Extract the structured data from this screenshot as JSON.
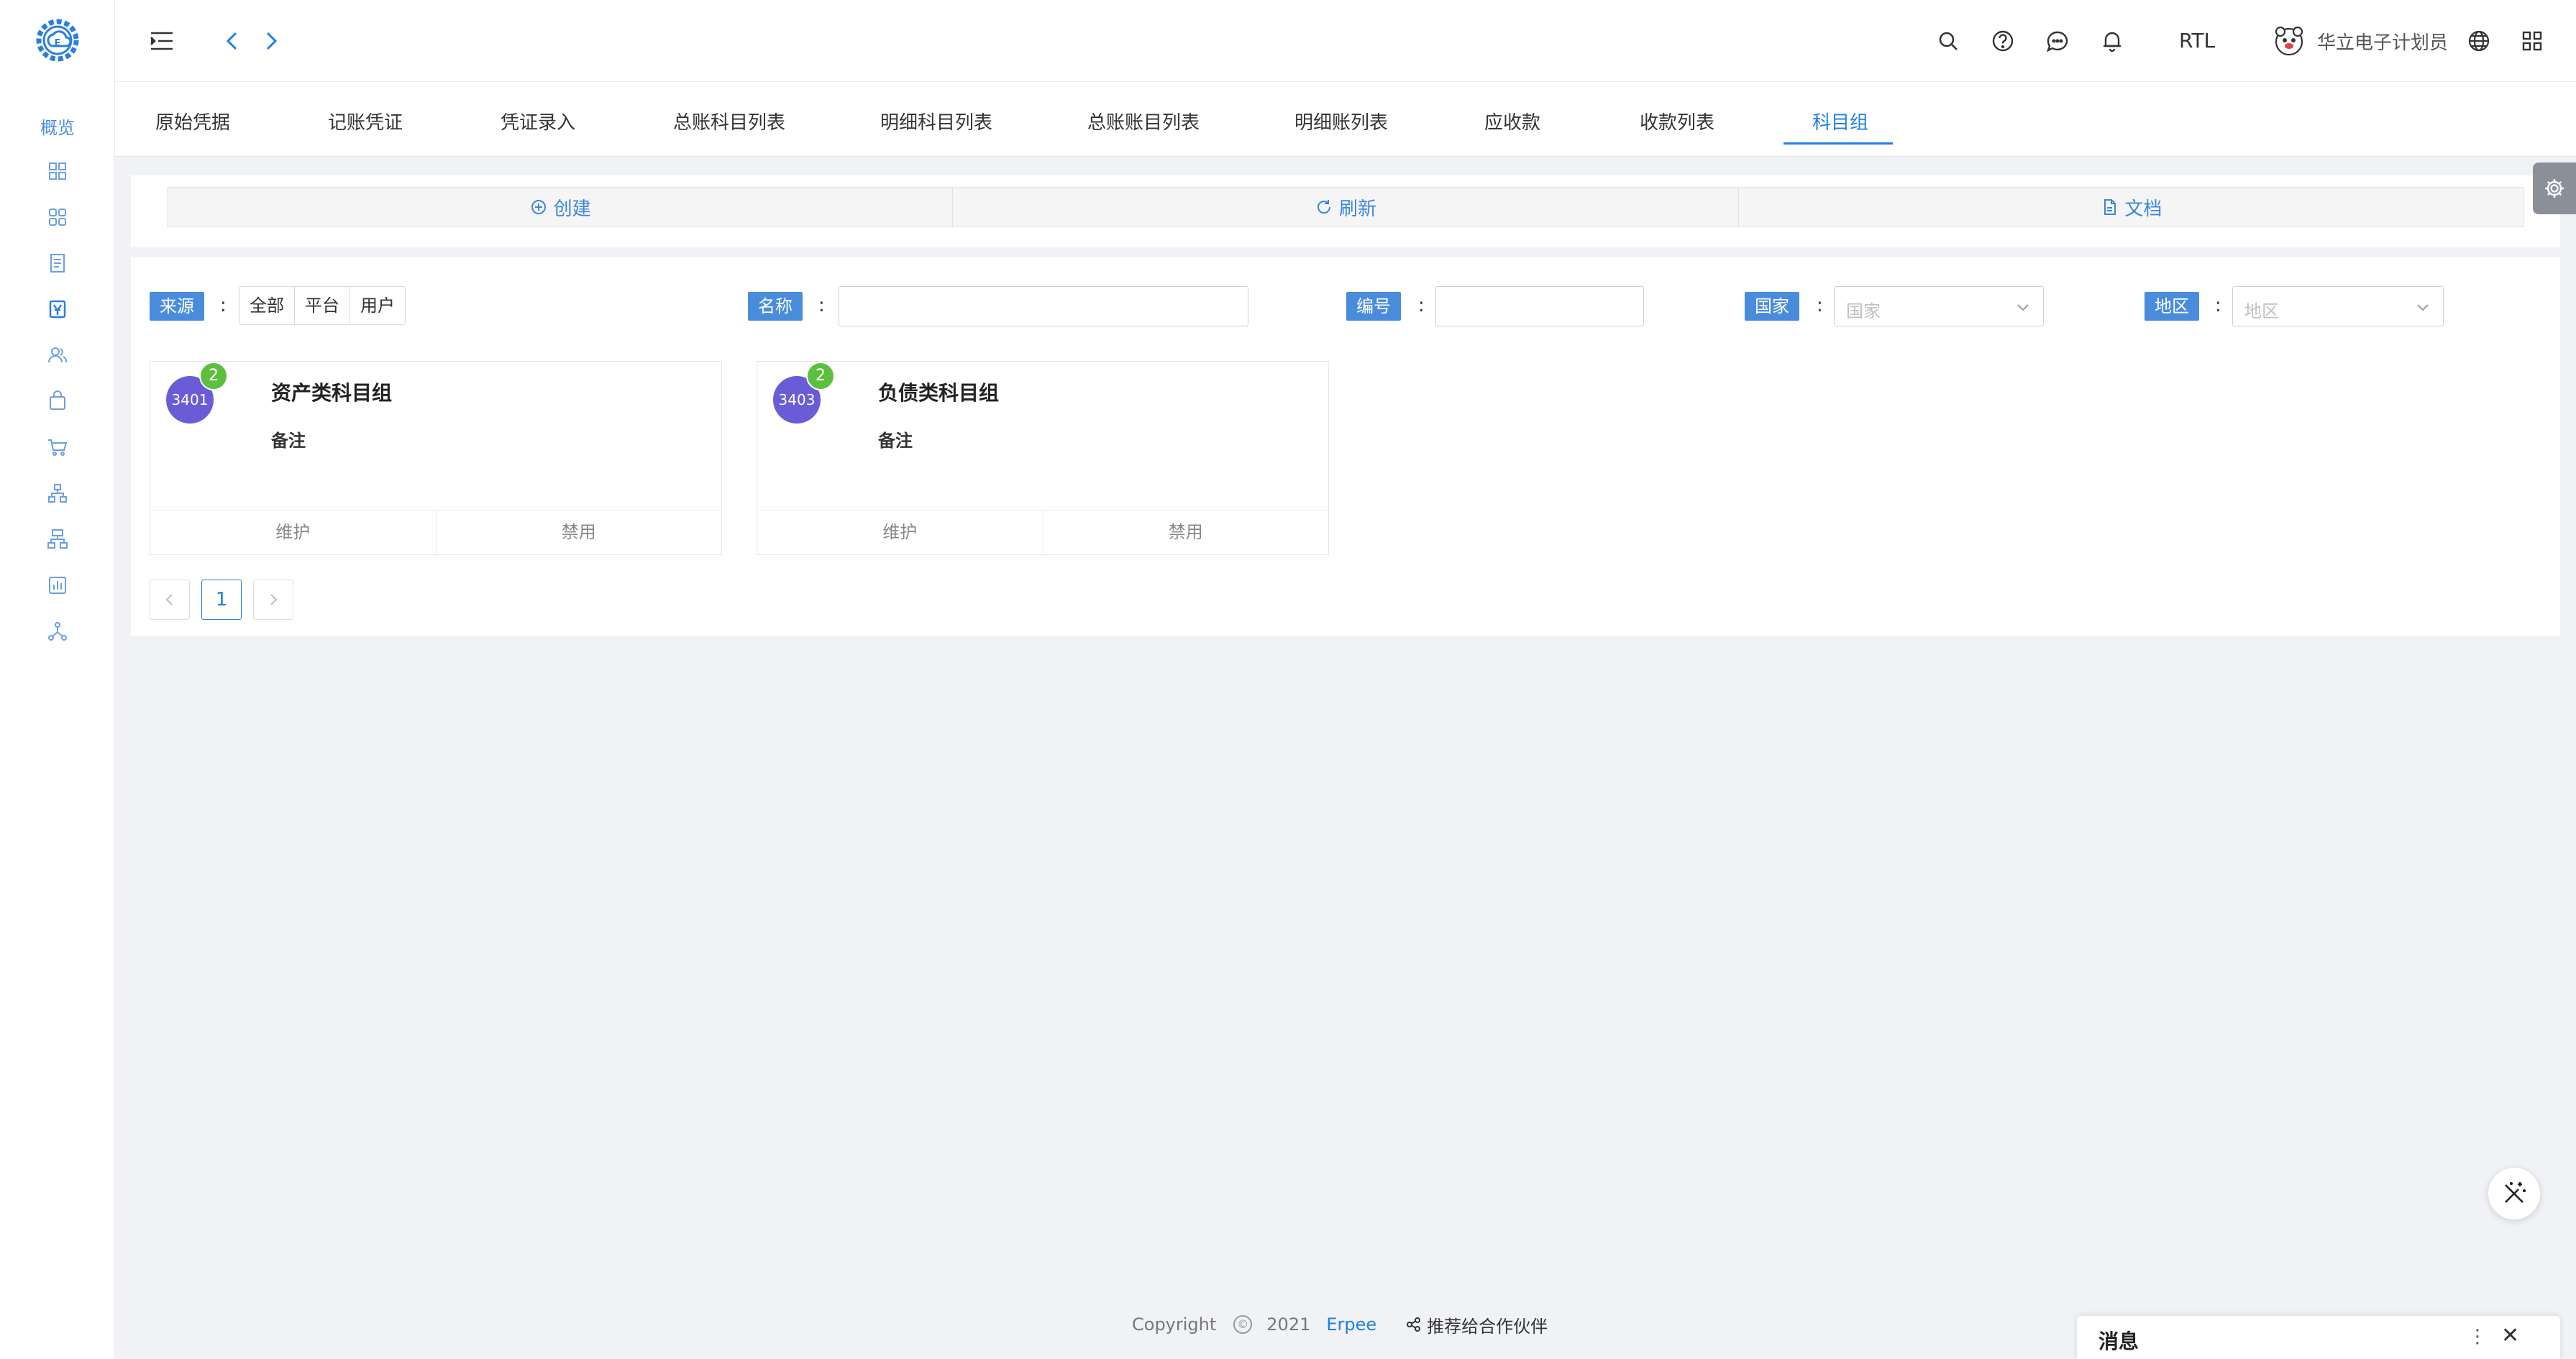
{
  "sidebar": {
    "overview_label": "概览",
    "nav_icons": [
      "dashboard-icon",
      "grid-icon",
      "document-icon",
      "voucher-icon",
      "users-icon",
      "bag-icon",
      "cart-icon",
      "org-chart-icon",
      "hierarchy-icon",
      "report-icon",
      "network-icon"
    ]
  },
  "header": {
    "icons": [
      "menu-fold-icon",
      "back-arrow-icon",
      "forward-arrow-icon",
      "search-icon",
      "help-icon",
      "chat-icon",
      "bell-icon",
      "globe-icon",
      "apps-icon"
    ],
    "rtl_label": "RTL",
    "user_name": "华立电子计划员"
  },
  "tabs": [
    {
      "label": "原始凭据",
      "active": false
    },
    {
      "label": "记账凭证",
      "active": false
    },
    {
      "label": "凭证录入",
      "active": false
    },
    {
      "label": "总账科目列表",
      "active": false
    },
    {
      "label": "明细科目列表",
      "active": false
    },
    {
      "label": "总账账目列表",
      "active": false
    },
    {
      "label": "明细账列表",
      "active": false
    },
    {
      "label": "应收款",
      "active": false
    },
    {
      "label": "收款列表",
      "active": false
    },
    {
      "label": "科目组",
      "active": true
    }
  ],
  "actions": {
    "create": "创建",
    "refresh": "刷新",
    "docs": "文档"
  },
  "filters": {
    "source_label": "来源",
    "source_options": [
      "全部",
      "平台",
      "用户"
    ],
    "name_label": "名称",
    "name_value": "",
    "code_label": "编号",
    "code_value": "",
    "country_label": "国家",
    "country_placeholder": "国家",
    "region_label": "地区",
    "region_placeholder": "地区",
    "colon": ":"
  },
  "cards": [
    {
      "code": "3401",
      "count": "2",
      "title": "资产类科目组",
      "note": "备注",
      "maintain": "维护",
      "disable": "禁用"
    },
    {
      "code": "3403",
      "count": "2",
      "title": "负债类科目组",
      "note": "备注",
      "maintain": "维护",
      "disable": "禁用"
    }
  ],
  "pagination": {
    "current": "1"
  },
  "footer": {
    "copyright": "Copyright",
    "copyright_symbol": "©",
    "year": "2021",
    "brand": "Erpee",
    "partner": "推荐给合作伙伴"
  },
  "message_panel": {
    "title": "消息",
    "more": "⋮",
    "close": "✕"
  },
  "colors": {
    "accent": "#1e80e3",
    "label_bg": "#4a8cdc",
    "badge_purple": "#6a5bd6",
    "badge_green": "#5cbf3e"
  }
}
